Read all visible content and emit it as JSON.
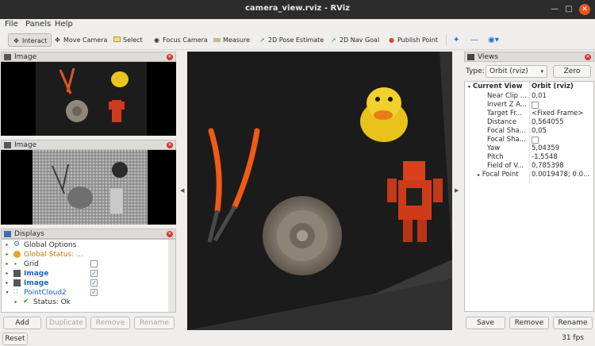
{
  "window": {
    "title": "camera_view.rviz - RViz"
  },
  "menu": {
    "file": "File",
    "panels": "Panels",
    "help": "Help"
  },
  "toolbar": {
    "interact": "Interact",
    "move_camera": "Move Camera",
    "select": "Select",
    "focus_camera": "Focus Camera",
    "measure": "Measure",
    "pose_estimate": "2D Pose Estimate",
    "nav_goal": "2D Nav Goal",
    "publish_point": "Publish Point"
  },
  "image_panel_1": {
    "title": "Image"
  },
  "image_panel_2": {
    "title": "Image"
  },
  "displays": {
    "title": "Displays",
    "items": [
      {
        "label": "Global Options",
        "color": "#2b2b2b"
      },
      {
        "label": "Global Status: ...",
        "color": "#c6790a"
      },
      {
        "label": "Grid",
        "color": "#2b2b2b"
      },
      {
        "label": "Image",
        "color": "#1e62c4"
      },
      {
        "label": "Image",
        "color": "#1e62c4"
      },
      {
        "label": "PointCloud2",
        "color": "#1e62c4"
      },
      {
        "label": "Status: Ok",
        "color": "#2b2b2b"
      }
    ],
    "buttons": {
      "add": "Add",
      "duplicate": "Duplicate",
      "remove": "Remove",
      "rename": "Rename"
    }
  },
  "views": {
    "title": "Views",
    "type_label": "Type:",
    "type_value": "Orbit (rviz)",
    "zero_label": "Zero",
    "current_view_label": "Current View",
    "current_view_value": "Orbit (rviz)",
    "props": [
      {
        "name": "Near Clip ...",
        "value": "0,01"
      },
      {
        "name": "Invert Z A...",
        "value": ""
      },
      {
        "name": "Target Fr...",
        "value": "<Fixed Frame>"
      },
      {
        "name": "Distance",
        "value": "0,564055"
      },
      {
        "name": "Focal Sha...",
        "value": "0,05"
      },
      {
        "name": "Focal Sha...",
        "value": ""
      },
      {
        "name": "Yaw",
        "value": "5,04359"
      },
      {
        "name": "Pitch",
        "value": "-1,5548"
      },
      {
        "name": "Field of V...",
        "value": "0,785398"
      },
      {
        "name": "Focal Point",
        "value": "0.0019478; 0.0..."
      }
    ],
    "buttons": {
      "save": "Save",
      "remove": "Remove",
      "rename": "Rename"
    }
  },
  "status": {
    "reset": "Reset",
    "fps": "31 fps"
  },
  "colors": {
    "accent_orange": "#e95420",
    "status_warn": "#c6790a",
    "link_blue": "#1e62c4"
  }
}
